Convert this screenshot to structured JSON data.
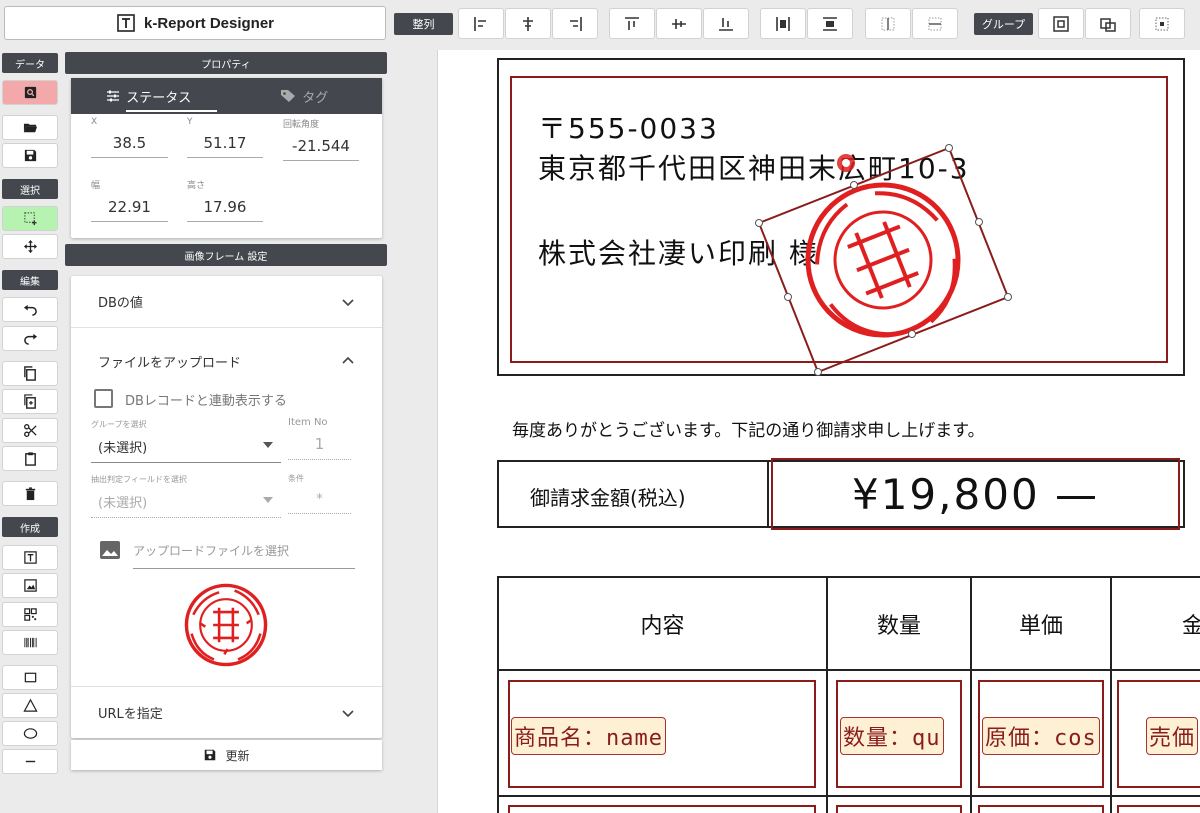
{
  "app": {
    "title": "k-Report Designer"
  },
  "toolbar": {
    "align_label": "整列",
    "group_label": "グループ"
  },
  "rail": {
    "data_label": "データ",
    "select_label": "選択",
    "edit_label": "編集",
    "create_label": "作成"
  },
  "properties": {
    "header": "プロパティ",
    "tab_status": "ステータス",
    "tab_tag": "タグ",
    "x_label": "X",
    "x_value": "38.5",
    "y_label": "Y",
    "y_value": "51.17",
    "rotation_label": "回転角度",
    "rotation_value": "-21.544",
    "width_label": "幅",
    "width_value": "22.91",
    "height_label": "高さ",
    "height_value": "17.96"
  },
  "image_frame": {
    "header": "画像フレーム 設定",
    "db_value": "DBの値",
    "upload": "ファイルをアップロード",
    "link_checkbox": "DBレコードと連動表示する",
    "group_select_label": "グループを選択",
    "group_select_value": "(未選択)",
    "item_no_label": "Item No",
    "item_no_value": "1",
    "field_select_label": "抽出判定フィールドを選択",
    "field_select_value": "(未選択)",
    "condition_label": "条件",
    "condition_value": "*",
    "file_select_placeholder": "アップロードファイルを選択",
    "url_label": "URLを指定",
    "update_button": "更新"
  },
  "document": {
    "postal": "〒555-0033",
    "address": "東京都千代田区神田末広町10-3",
    "company": "株式会社凄い印刷 様",
    "greeting": "毎度ありがとうございます。下記の通り御請求申し上げます。",
    "total_label": "御請求金額(税込)",
    "total_value": "¥19,800 —",
    "columns": [
      "内容",
      "数量",
      "単価",
      "金"
    ],
    "row_fields": [
      "商品名：name",
      "数量：qu",
      "原価：cos",
      "売価"
    ]
  },
  "colors": {
    "dark": "#44474d",
    "frame_red": "#8a1c1c",
    "stamp_red": "#e02020",
    "data_btn_bg": "#f3a9a9",
    "select_btn_bg": "#b6f2b0"
  }
}
